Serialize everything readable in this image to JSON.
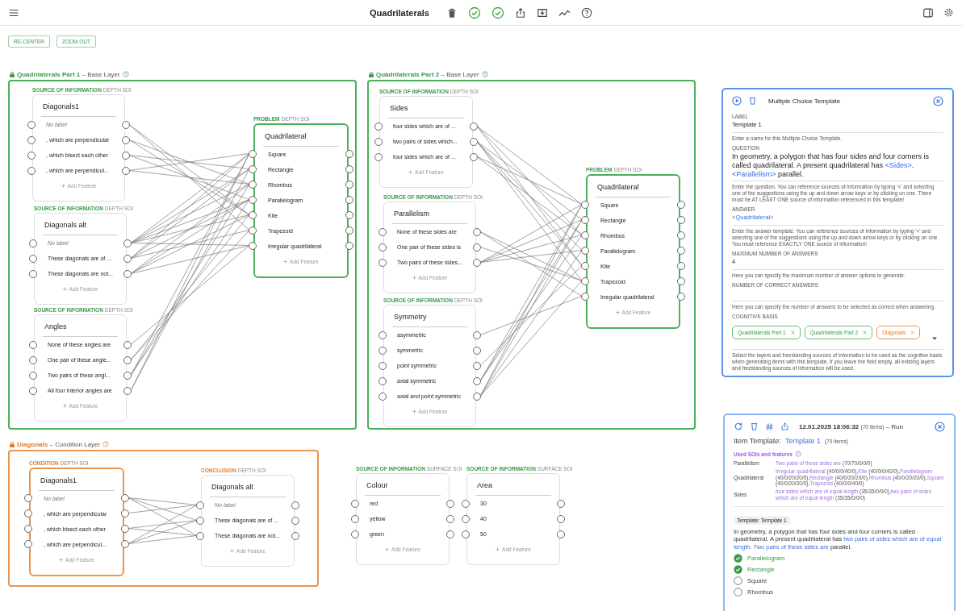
{
  "toolbar": {
    "title": "Quadrilaterals"
  },
  "view_buttons": [
    "RE-CENTER",
    "ZOOM OUT"
  ],
  "layers": [
    {
      "name": "Quadrilaterals Part 1",
      "type": "– Base Layer",
      "kind": "base",
      "nodes": [
        {
          "role": "SOURCE OF INFORMATION",
          "depth": "DEPTH SOI",
          "kind": "source",
          "title": "Diagonals1",
          "add": "Add Feature",
          "features": [
            {
              "label": "No label",
              "kind": "unlabeled"
            },
            {
              "label": ", which are perpendicular",
              "kind": "labeled"
            },
            {
              "label": ", which bisect each other",
              "kind": "labeled"
            },
            {
              "label": ", which are perpendicul...",
              "kind": "labeled"
            }
          ]
        },
        {
          "role": "SOURCE OF INFORMATION",
          "depth": "DEPTH SOI",
          "kind": "source",
          "title": "Diagonals alt",
          "add": "Add Feature",
          "features": [
            {
              "label": "No label",
              "kind": "unlabeled"
            },
            {
              "label": "These diagonals are of ...",
              "kind": "labeled"
            },
            {
              "label": "These diagonals are not...",
              "kind": "labeled"
            }
          ]
        },
        {
          "role": "SOURCE OF INFORMATION",
          "depth": "DEPTH SOI",
          "kind": "source",
          "title": "Angles",
          "add": "Add Feature",
          "features": [
            {
              "label": "None of these angles are",
              "kind": "labeled"
            },
            {
              "label": "One pair of these angle...",
              "kind": "labeled"
            },
            {
              "label": "Two pairs of these angl...",
              "kind": "labeled"
            },
            {
              "label": "All four interior angles are",
              "kind": "labeled"
            }
          ]
        },
        {
          "role": "PROBLEM",
          "depth": "DEPTH SOI",
          "kind": "problem",
          "title": "Quadrilateral",
          "add": "Add Feature",
          "features": [
            {
              "label": "Square",
              "kind": "labeled"
            },
            {
              "label": "Rectangle",
              "kind": "labeled"
            },
            {
              "label": "Rhombus",
              "kind": "labeled"
            },
            {
              "label": "Parallelogram",
              "kind": "labeled"
            },
            {
              "label": "Kite",
              "kind": "labeled"
            },
            {
              "label": "Trapezoid",
              "kind": "labeled"
            },
            {
              "label": "Irregular quadrilateral",
              "kind": "labeled"
            }
          ]
        }
      ]
    },
    {
      "name": "Quadrilaterals Part 2",
      "type": "– Base Layer",
      "kind": "base",
      "nodes": [
        {
          "role": "SOURCE OF INFORMATION",
          "depth": "DEPTH SOI",
          "kind": "source",
          "title": "Sides",
          "add": "Add Feature",
          "features": [
            {
              "label": "four sides which are of ...",
              "kind": "labeled"
            },
            {
              "label": "two pairs of sides which...",
              "kind": "labeled"
            },
            {
              "label": "four sides which are of ...",
              "kind": "labeled"
            }
          ]
        },
        {
          "role": "SOURCE OF INFORMATION",
          "depth": "DEPTH SOI",
          "kind": "source",
          "title": "Parallelism",
          "add": "Add Feature",
          "features": [
            {
              "label": "None of these sides are",
              "kind": "labeled"
            },
            {
              "label": "One pair of these sides is",
              "kind": "labeled"
            },
            {
              "label": "Two pairs of these sides...",
              "kind": "labeled"
            }
          ]
        },
        {
          "role": "SOURCE OF INFORMATION",
          "depth": "DEPTH SOI",
          "kind": "source",
          "title": "Symmetry",
          "add": "Add Feature",
          "features": [
            {
              "label": "asymmetric",
              "kind": "labeled"
            },
            {
              "label": "symmetric",
              "kind": "labeled"
            },
            {
              "label": "point symmetric",
              "kind": "labeled"
            },
            {
              "label": "axial symmetric",
              "kind": "labeled"
            },
            {
              "label": "axial and point symmetric",
              "kind": "labeled"
            }
          ]
        },
        {
          "role": "PROBLEM",
          "depth": "DEPTH SOI",
          "kind": "problem",
          "title": "Quadrilateral",
          "add": "Add Feature",
          "features": [
            {
              "label": "Square",
              "kind": "labeled"
            },
            {
              "label": "Rectangle",
              "kind": "labeled"
            },
            {
              "label": "Rhombus",
              "kind": "labeled"
            },
            {
              "label": "Parallelogram",
              "kind": "labeled"
            },
            {
              "label": "Kite",
              "kind": "labeled"
            },
            {
              "label": "Trapezoid",
              "kind": "labeled"
            },
            {
              "label": "Irregular quadrilateral",
              "kind": "labeled"
            }
          ]
        }
      ]
    },
    {
      "name": "Diagonals",
      "type": "– Condition Layer",
      "kind": "condition",
      "nodes": [
        {
          "role": "CONDITION",
          "depth": "DEPTH SOI",
          "kind": "condition",
          "title": "Diagonals1",
          "add": "Add Feature",
          "features": [
            {
              "label": "No label",
              "kind": "unlabeled"
            },
            {
              "label": ", which are perpendicular",
              "kind": "labeled"
            },
            {
              "label": ", which bisect each other",
              "kind": "labeled"
            },
            {
              "label": ", which are perpendicul...",
              "kind": "labeled"
            }
          ]
        },
        {
          "role": "CONCLUSION",
          "depth": "DEPTH SOI",
          "kind": "conclusion",
          "title": "Diagonals alt",
          "add": "Add Feature",
          "features": [
            {
              "label": "No label",
              "kind": "unlabeled"
            },
            {
              "label": "These diagonals are of ...",
              "kind": "labeled"
            },
            {
              "label": "These diagonals are not...",
              "kind": "labeled"
            }
          ]
        }
      ]
    }
  ],
  "free_nodes": [
    {
      "role": "SOURCE OF INFORMATION",
      "depth": "SURFACE SOI",
      "kind": "source",
      "title": "Colour",
      "add": "Add Feature",
      "features": [
        {
          "label": "red",
          "kind": "labeled"
        },
        {
          "label": "yellow",
          "kind": "labeled"
        },
        {
          "label": "green",
          "kind": "labeled"
        }
      ]
    },
    {
      "role": "SOURCE OF INFORMATION",
      "depth": "SURFACE SOI",
      "kind": "source",
      "title": "Area",
      "add": "Add Feature",
      "features": [
        {
          "label": "30",
          "kind": "labeled"
        },
        {
          "label": "40",
          "kind": "labeled"
        },
        {
          "label": "50",
          "kind": "labeled"
        }
      ]
    }
  ],
  "template_panel": {
    "title": "Multiple Choice Template",
    "fields": [
      {
        "label": "LABEL",
        "kind": "text",
        "value": [
          {
            "text": "Template 1",
            "kind": "plain"
          }
        ],
        "help": "Enter a name for this Multiple Choice Template."
      },
      {
        "label": "QUESTION",
        "kind": "question",
        "value": [
          {
            "text": "In geometry, a polygon that has four sides and four corners is called quadrilateral. A present quadrilateral has ",
            "kind": "plain"
          },
          {
            "text": "<Sides>",
            "kind": "reference"
          },
          {
            "text": ". ",
            "kind": "plain"
          },
          {
            "text": "<Parallelism>",
            "kind": "reference"
          },
          {
            "text": " parallel.",
            "kind": "plain"
          }
        ],
        "help": "Enter the question. You can reference sources of information by typing '<' and selecting one of the suggestions using the up and down arrow keys or by clicking on one. There must be AT LEAST ONE source of information referenced in this template!"
      },
      {
        "label": "ANSWER",
        "kind": "text",
        "value": [
          {
            "text": "<Quadrilateral>",
            "kind": "reference"
          }
        ],
        "help": "Enter the answer template. You can reference sources of information by typing '<' and selecting one of the suggestions using the up and down arrow keys or by clicking on one. You must reference EXACTLY ONE source of information!"
      },
      {
        "label": "MAXIMUM NUMBER OF ANSWERS",
        "kind": "text",
        "value": [
          {
            "text": "4",
            "kind": "plain"
          }
        ],
        "help": "Here you can specify the maximum number of answer options to generate."
      },
      {
        "label": "NUMBER OF CORRECT ANSWERS",
        "kind": "text",
        "help": "Here you can specify the number of answers to be selected as correct when answering."
      }
    ],
    "basis": {
      "label": "COGNITIVE BASIS",
      "chips": [
        {
          "label": "Quadrilaterals Part 1",
          "kind": "base"
        },
        {
          "label": "Quadrilaterals Part 2",
          "kind": "base"
        },
        {
          "label": "Diagonals",
          "kind": "condition"
        }
      ],
      "help": "Select the layers and freestanding sources of information to be used as the cognitive basis when generating items with this template. If you leave the field empty, all existing layers and freestanding sources of information will be used."
    }
  },
  "run_panel": {
    "timestamp": "12.01.2025 18:06:32",
    "count": "(70 items)",
    "status": "– Run",
    "item_template": {
      "label": "Item Template:",
      "name": "Template 1",
      "count": "(70 items)"
    },
    "used": {
      "title": "Used SOIs and features",
      "rows": [
        {
          "soi": "Parallelism",
          "features": [
            {
              "name": "Two pairs of these sides are",
              "stats": "(70/70/0/0/0)"
            }
          ]
        },
        {
          "soi": "Quadrilateral",
          "features": [
            {
              "name": "Irregular quadrilateral",
              "stats": "(40/0/0/40/0),"
            },
            {
              "name": "Kite",
              "stats": "(40/0/0/40/0),"
            },
            {
              "name": "Parallelogram",
              "stats": "(40/0/20/20/0),"
            },
            {
              "name": "Rectangle",
              "stats": "(40/0/20/20/0),"
            },
            {
              "name": "Rhombus",
              "stats": "(40/0/20/20/0),"
            },
            {
              "name": "Square",
              "stats": "(40/0/20/20/0),"
            },
            {
              "name": "Trapezoid",
              "stats": "(40/0/0/40/0)"
            }
          ]
        },
        {
          "soi": "Sides",
          "features": [
            {
              "name": "four sides which are of equal length",
              "stats": "(35/35/0/0/0),"
            },
            {
              "name": "two pairs of sides which are of equal length",
              "stats": "(35/35/0/0/0)"
            }
          ]
        }
      ]
    },
    "preview": {
      "chip": "Template: Template 1",
      "question": [
        {
          "text": "In geometry, a polygon that has four sides and four corners is called quadrilateral. A present quadrilateral has ",
          "kind": "plain"
        },
        {
          "text": "two pairs of sides which are of equal length. ",
          "kind": "reference"
        },
        {
          "text": "Two pairs of these sides are",
          "kind": "reference"
        },
        {
          "text": " parallel.",
          "kind": "plain"
        }
      ],
      "answers": [
        {
          "label": "Parallelogram",
          "correct": true
        },
        {
          "label": "Rectangle",
          "correct": true
        },
        {
          "label": "Square",
          "correct": false
        },
        {
          "label": "Rhombus",
          "correct": false
        }
      ]
    }
  }
}
